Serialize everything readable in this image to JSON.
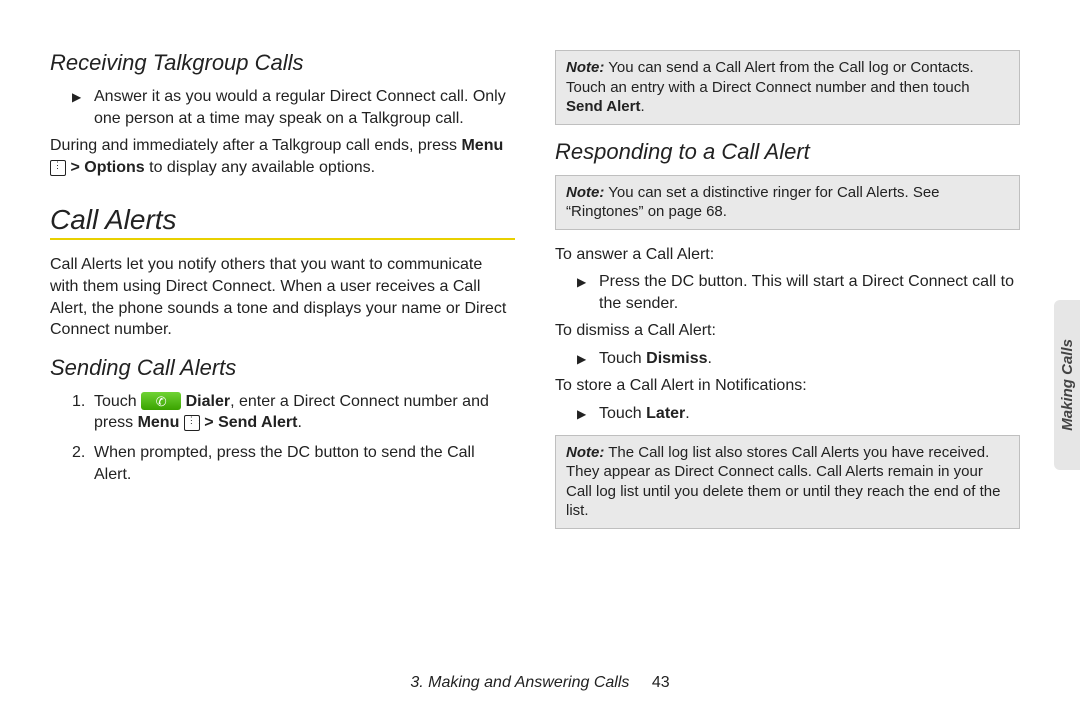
{
  "left": {
    "h_receiving": "Receiving Talkgroup Calls",
    "receiving_bullet": "Answer it as you would a regular Direct Connect call. Only one person at a time may speak on a Talkgroup call.",
    "receiving_after_pre": "During and immediately after a Talkgroup call ends, press ",
    "menu_label": "Menu",
    "options_label": "Options",
    "receiving_after_post": " to display any available options.",
    "h_call_alerts": "Call Alerts",
    "call_alerts_intro": "Call Alerts let you notify others that you want to communicate with them using Direct Connect. When a user receives a Call Alert, the phone sounds a tone and displays your name or Direct Connect number.",
    "h_sending": "Sending Call Alerts",
    "send1_pre": "Touch ",
    "dialer_label": "Dialer",
    "send1_mid": ", enter a Direct Connect number and press ",
    "send_alert_label": "Send Alert",
    "send2": "When prompted, press the DC button to send the Call Alert."
  },
  "right": {
    "note1_label": "Note:",
    "note1_text_pre": "You can send a Call Alert from the Call log or Contacts. Touch an entry with a Direct Connect number and then touch ",
    "note1_bold": "Send Alert",
    "h_responding": "Responding to a Call Alert",
    "note2_label": "Note:",
    "note2_text": "You can set a distinctive ringer for Call Alerts. See “Ringtones” on page 68.",
    "answer_lead": "To answer a Call Alert:",
    "answer_bullet": "Press the DC button. This will start a Direct Connect call to the sender.",
    "dismiss_lead": "To dismiss a Call Alert:",
    "dismiss_pre": "Touch ",
    "dismiss_bold": "Dismiss",
    "store_lead": "To store a Call Alert in Notifications:",
    "store_pre": "Touch ",
    "store_bold": "Later",
    "note3_label": "Note:",
    "note3_text": "The Call log list also stores Call Alerts you have received. They appear as Direct Connect calls. Call Alerts remain in your Call log list until you delete them or until they reach the end of the list."
  },
  "footer": {
    "chapter": "3. Making and Answering Calls",
    "page": "43"
  },
  "sidetab": "Making Calls",
  "gt": ">"
}
